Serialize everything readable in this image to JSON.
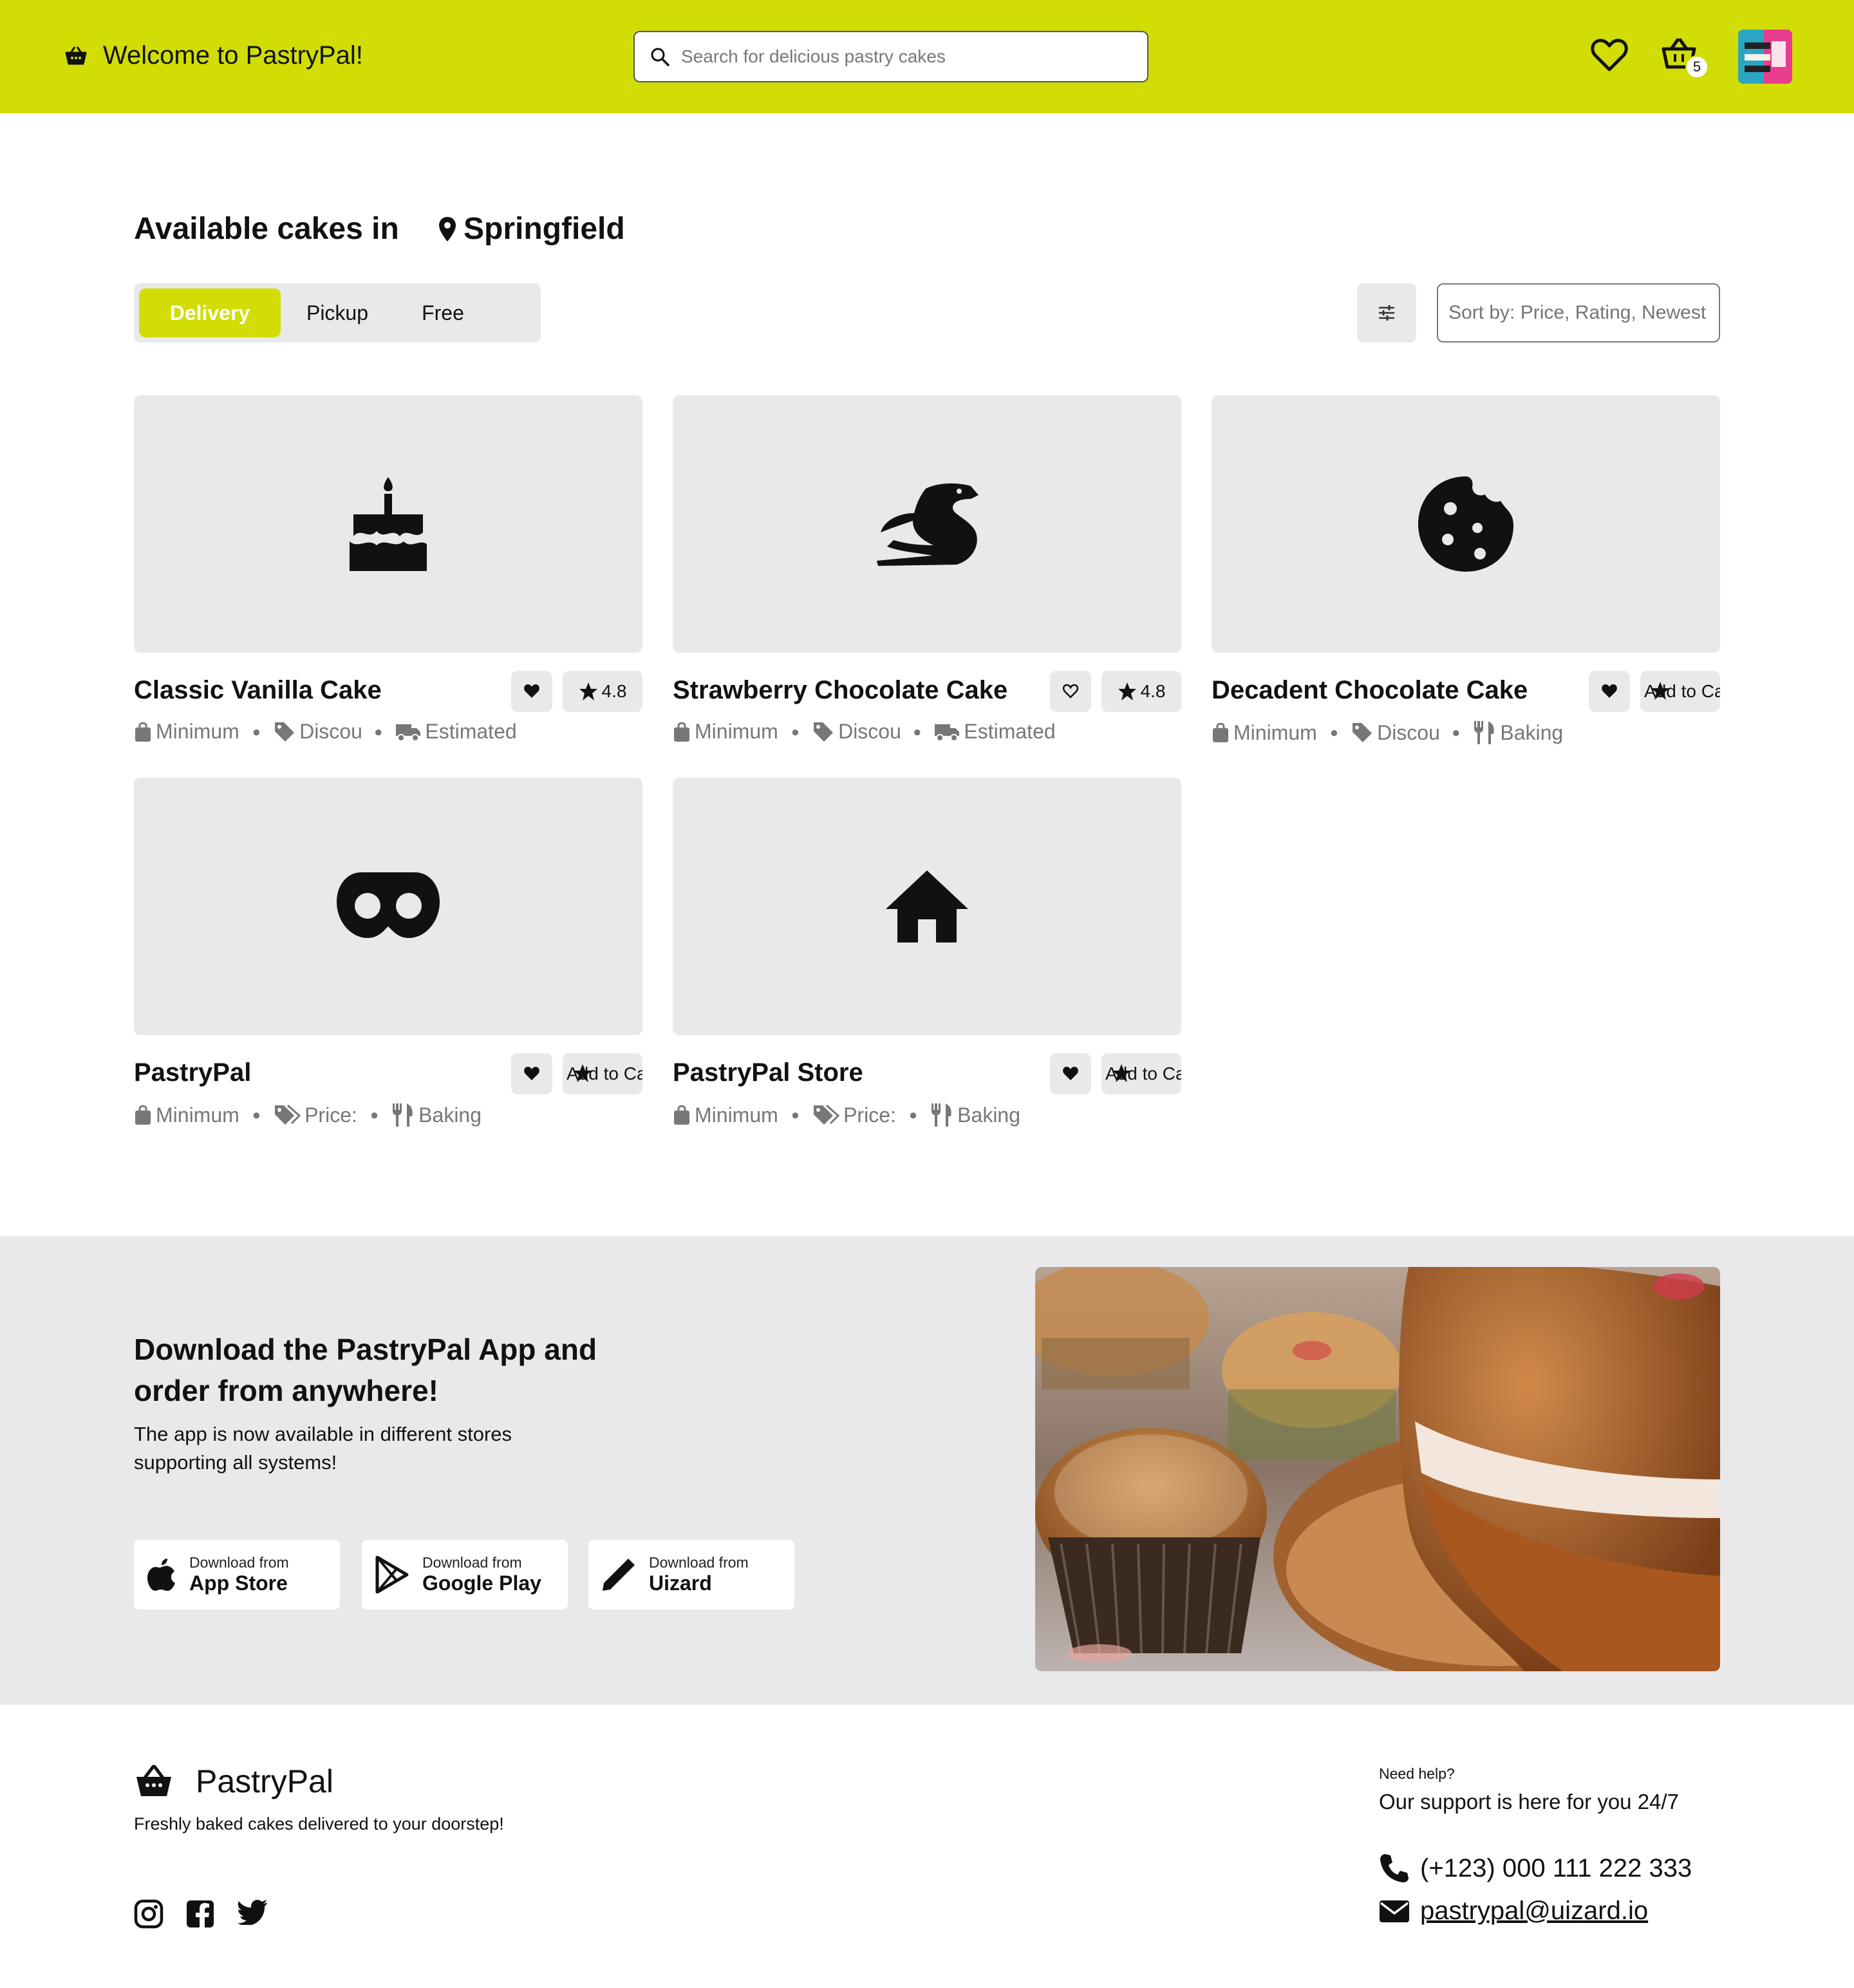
{
  "header": {
    "brand_label": "Welcome to PastryPal!",
    "search_placeholder": "Search for delicious pastry cakes",
    "cart_count": "5",
    "accent_color": "#d1dd05"
  },
  "main": {
    "title": "Available cakes in",
    "location": "Springfield",
    "tabs": [
      {
        "label": "Delivery",
        "active": true
      },
      {
        "label": "Pickup",
        "active": false
      },
      {
        "label": "Free",
        "active": false
      }
    ],
    "sort_placeholder": "Sort by: Price, Rating, Newest"
  },
  "cards": [
    {
      "name": "Classic Vanilla Cake",
      "icon": "birthday-cake-icon",
      "badge": "4.8",
      "meta": [
        "Minimum",
        "Discou",
        "Estimated"
      ]
    },
    {
      "name": "Strawberry Chocolate Cake",
      "icon": "dragon-icon",
      "badge": "4.8",
      "meta": [
        "Minimum",
        "Discou",
        "Estimated"
      ]
    },
    {
      "name": "Decadent Chocolate Cake",
      "icon": "cookie-icon",
      "badge": "Add to Ca",
      "meta": [
        "Minimum",
        "Discou",
        "Baking"
      ]
    },
    {
      "name": "PastryPal",
      "icon": "mask-icon",
      "badge": "Add to Ca",
      "meta": [
        "Minimum",
        "Price:",
        "Baking"
      ]
    },
    {
      "name": "PastryPal Store",
      "icon": "house-icon",
      "badge": "Add to Ca",
      "meta": [
        "Minimum",
        "Price:",
        "Baking"
      ]
    }
  ],
  "promo": {
    "heading": "Download the PastryPal App and order from anywhere!",
    "subtext": "The app is now available in different stores supporting all systems!",
    "stores": [
      {
        "small": "Download from",
        "large": "App Store"
      },
      {
        "small": "Download from",
        "large": "Google Play"
      },
      {
        "small": "Download from",
        "large": "Uizard"
      }
    ]
  },
  "footer": {
    "brand": "PastryPal",
    "tagline": "Freshly baked cakes delivered to your doorstep!",
    "help_small": "Need help?",
    "help_large": "Our support is here for you 24/7",
    "phone": "(+123) 000 111 222 333",
    "email": "pastrypal@uizard.io"
  }
}
